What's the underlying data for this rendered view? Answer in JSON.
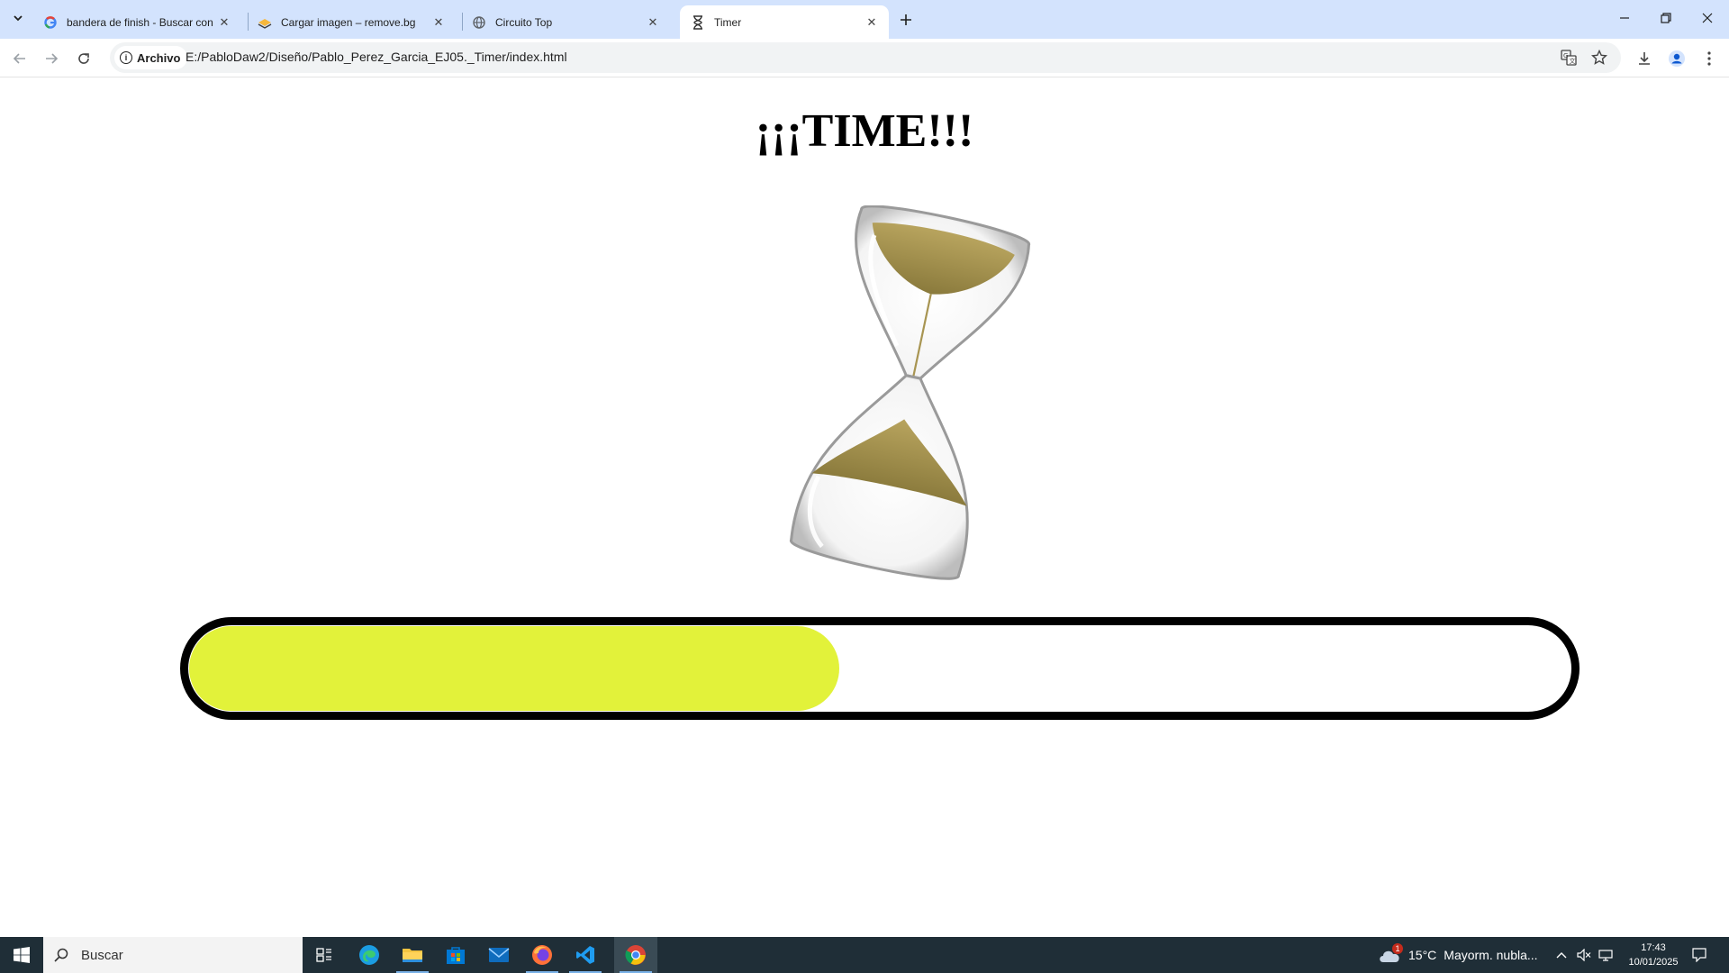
{
  "browser": {
    "tabs": [
      {
        "title": "bandera de finish - Buscar con Google",
        "active": false,
        "favicon": "google-icon"
      },
      {
        "title": "Cargar imagen – remove.bg",
        "active": false,
        "favicon": "removebg-icon"
      },
      {
        "title": "Circuito Top",
        "active": false,
        "favicon": "globe-icon"
      },
      {
        "title": "Timer",
        "active": true,
        "favicon": "hourglass-icon"
      }
    ],
    "address": {
      "chip_label": "Archivo",
      "url": "E:/PabloDaw2/Diseño/Pablo_Perez_Garcia_EJ05._Timer/index.html"
    }
  },
  "page": {
    "title": "¡¡¡TIME!!!",
    "progress": {
      "fraction": 0.47,
      "fill_color": "#e2f23a",
      "border_color": "#000000"
    }
  },
  "taskbar": {
    "search_placeholder": "Buscar",
    "weather": {
      "temp": "15°C",
      "desc": "Mayorm. nubla...",
      "badge": "1"
    },
    "time": "17:43",
    "date": "10/01/2025"
  }
}
